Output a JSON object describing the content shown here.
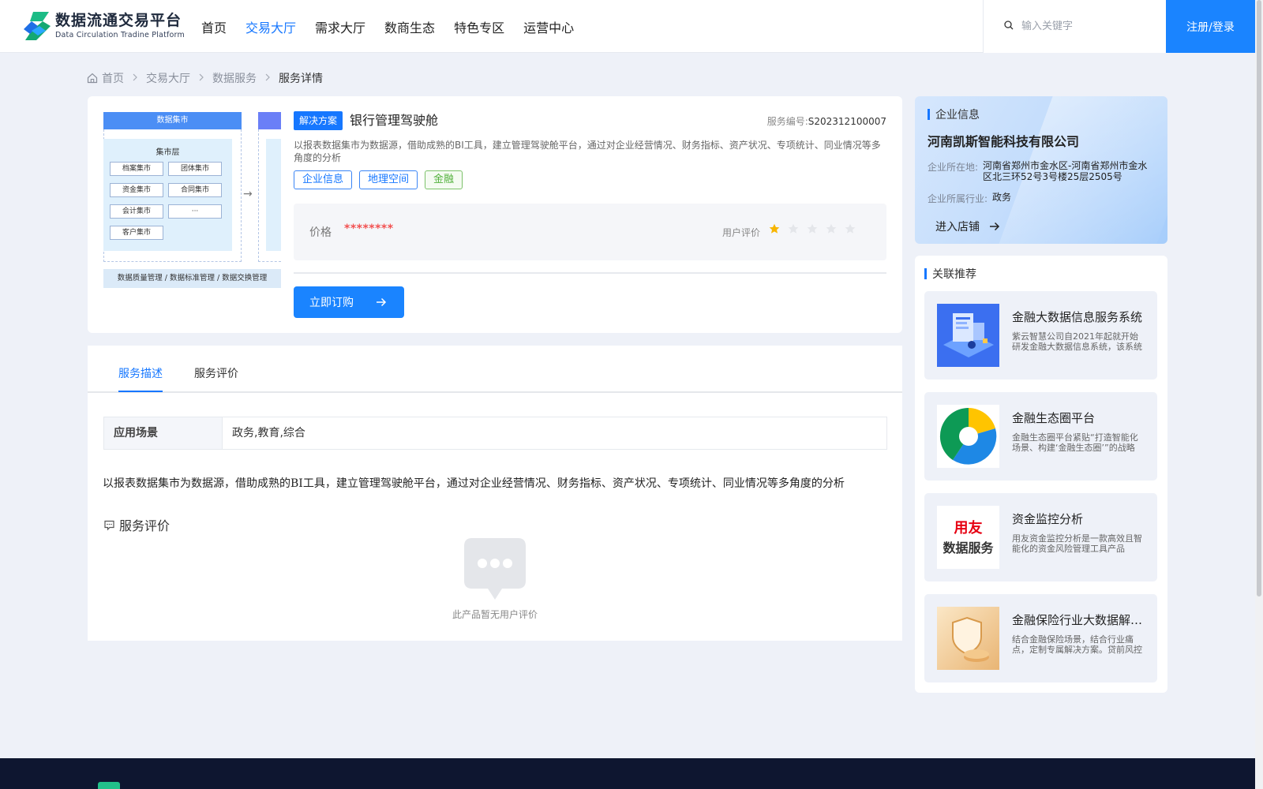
{
  "header": {
    "logo_cn": "数据流通交易平台",
    "logo_en": "Data Circulation Tradine Platform",
    "nav": [
      "首页",
      "交易大厅",
      "需求大厅",
      "数商生态",
      "特色专区",
      "运营中心"
    ],
    "active_nav": "交易大厅",
    "search_placeholder": "输入关键字",
    "login_label": "注册/登录"
  },
  "breadcrumb": [
    "首页",
    "交易大厅",
    "数据服务",
    "服务详情"
  ],
  "product": {
    "thumbnail": {
      "header": "数据集市",
      "layer_title": "集市层",
      "boxes": [
        "档案集市",
        "团体集市",
        "资金集市",
        "合同集市",
        "会计集市",
        "···",
        "客户集市"
      ],
      "footer": "数据质量管理 / 数据标准管理 / 数据交换管理"
    },
    "badge": "解决方案",
    "title": "银行管理驾驶舱",
    "serial_label": "服务编号:",
    "serial_value": "S202312100007",
    "description": "以报表数据集市为数据源，借助成熟的BI工具，建立管理驾驶舱平台，通过对企业经营情况、财务指标、资产状况、专项统计、同业情况等多角度的分析",
    "tags": [
      "企业信息",
      "地理空间",
      "金融"
    ],
    "price_label": "价格",
    "price_value": "********",
    "rating_label": "用户评价",
    "rating": 1,
    "rating_max": 5,
    "buy_label": "立即订购"
  },
  "tabs": {
    "items": [
      "服务描述",
      "服务评价"
    ],
    "active": "服务描述",
    "attr_key": "应用场景",
    "attr_value": "政务,教育,综合",
    "long_description": "以报表数据集市为数据源，借助成熟的BI工具，建立管理驾驶舱平台，通过对企业经营情况、财务指标、资产状况、专项统计、同业情况等多角度的分析",
    "review_title": "服务评价",
    "empty_text": "此产品暂无用户评价"
  },
  "company": {
    "section_title": "企业信息",
    "name": "河南凯斯智能科技有限公司",
    "location_label": "企业所在地:",
    "location_value": "河南省郑州市金水区-河南省郑州市金水区北三环52号3号楼25层2505号",
    "industry_label": "企业所属行业:",
    "industry_value": "政务",
    "enter_label": "进入店铺"
  },
  "recommend": {
    "section_title": "关联推荐",
    "items": [
      {
        "title": "金融大数据信息服务系统",
        "desc": "紫云智慧公司自2021年起就开始研发金融大数据信息系统，该系统"
      },
      {
        "title": "金融生态圈平台",
        "desc": "金融生态圈平台紧贴“打造智能化场景、构建‘金融生态圈’”的战略"
      },
      {
        "title": "资金监控分析",
        "desc": "用友资金监控分析是一款高效且智能化的资金风险管理工具产品"
      },
      {
        "title": "金融保险行业大数据解决方案",
        "desc": "结合金融保险场景，结合行业痛点，定制专属解决方案。贷前风控"
      }
    ],
    "yonyou_logo": [
      "用友",
      "数据服务"
    ]
  },
  "colors": {
    "primary": "#1677ff",
    "price": "#f25151",
    "star_on": "#f7b500",
    "footer_bg": "#0e1630"
  }
}
